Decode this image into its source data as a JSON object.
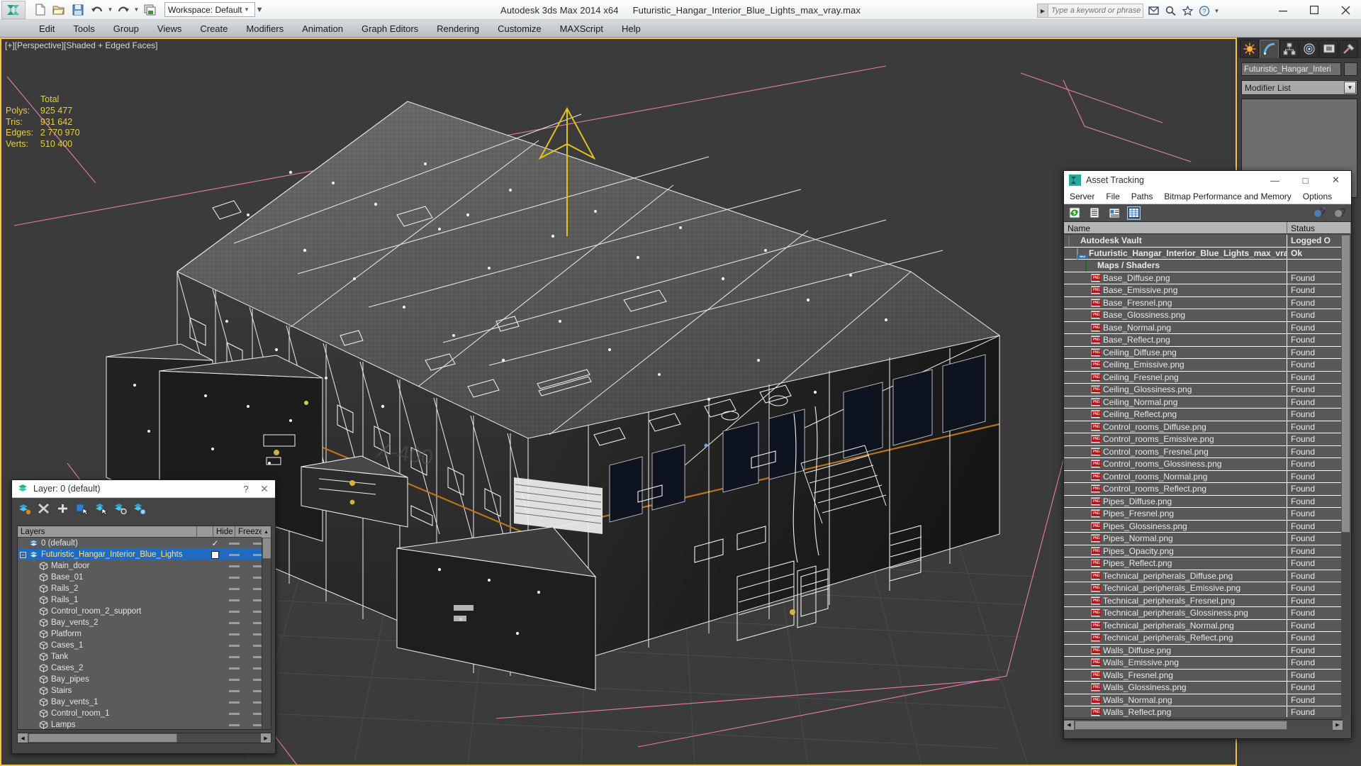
{
  "app": {
    "title_product": "Autodesk 3ds Max  2014 x64",
    "title_file": "Futuristic_Hangar_Interior_Blue_Lights_max_vray.max",
    "workspace_label": "Workspace: Default",
    "search_placeholder": "Type a keyword or phrase",
    "quick_access": [
      "new-file-icon",
      "open-file-icon",
      "save-file-icon",
      "undo-icon",
      "redo-icon",
      "project-folder-icon"
    ],
    "window_buttons": [
      "minimize",
      "maximize",
      "close"
    ]
  },
  "menubar": {
    "items": [
      "Edit",
      "Tools",
      "Group",
      "Views",
      "Create",
      "Modifiers",
      "Animation",
      "Graph Editors",
      "Rendering",
      "Customize",
      "MAXScript",
      "Help"
    ]
  },
  "viewport": {
    "label": "[+][Perspective][Shaded + Edged Faces]",
    "stats_header": "Total",
    "stats": [
      {
        "label": "Polys:",
        "value": "925 477"
      },
      {
        "label": "Tris:",
        "value": "931 642"
      },
      {
        "label": "Edges:",
        "value": "2 770 970"
      },
      {
        "label": "Verts:",
        "value": "510 400"
      }
    ],
    "stats_color": "#e9cf3a",
    "active_border_color": "#f2c744"
  },
  "command_panel": {
    "tabs": [
      "create-tab",
      "modify-tab",
      "hierarchy-tab",
      "motion-tab",
      "display-tab",
      "utilities-tab"
    ],
    "active_tab_index": 1,
    "object_name": "Futuristic_Hangar_Interi",
    "modifier_list_label": "Modifier List"
  },
  "layer_dialog": {
    "title": "Layer: 0 (default)",
    "help_label": "?",
    "close_label": "✕",
    "toolbar": [
      "delete-layer-icon",
      "remove-layer-icon",
      "add-layer-icon",
      "select-objects-icon",
      "select-highlighted-icon",
      "highlight-selected-icon",
      "layer-properties-icon"
    ],
    "columns": [
      "Layers",
      "",
      "Hide",
      "Freeze"
    ],
    "rows": [
      {
        "name": "0 (default)",
        "indent": 1,
        "icon": "layer-icon",
        "check": "✓",
        "selected": false
      },
      {
        "name": "Futuristic_Hangar_Interior_Blue_Lights",
        "indent": 1,
        "icon": "layer-icon",
        "check": "box",
        "selected": true,
        "expander": "−"
      },
      {
        "name": "Main_door",
        "indent": 2,
        "icon": "object-icon",
        "selected": false
      },
      {
        "name": "Base_01",
        "indent": 2,
        "icon": "object-icon",
        "selected": false
      },
      {
        "name": "Rails_2",
        "indent": 2,
        "icon": "object-icon",
        "selected": false
      },
      {
        "name": "Rails_1",
        "indent": 2,
        "icon": "object-icon",
        "selected": false
      },
      {
        "name": "Control_room_2_support",
        "indent": 2,
        "icon": "object-icon",
        "selected": false
      },
      {
        "name": "Bay_vents_2",
        "indent": 2,
        "icon": "object-icon",
        "selected": false
      },
      {
        "name": "Platform",
        "indent": 2,
        "icon": "object-icon",
        "selected": false
      },
      {
        "name": "Cases_1",
        "indent": 2,
        "icon": "object-icon",
        "selected": false
      },
      {
        "name": "Tank",
        "indent": 2,
        "icon": "object-icon",
        "selected": false
      },
      {
        "name": "Cases_2",
        "indent": 2,
        "icon": "object-icon",
        "selected": false
      },
      {
        "name": "Bay_pipes",
        "indent": 2,
        "icon": "object-icon",
        "selected": false
      },
      {
        "name": "Stairs",
        "indent": 2,
        "icon": "object-icon",
        "selected": false
      },
      {
        "name": "Bay_vents_1",
        "indent": 2,
        "icon": "object-icon",
        "selected": false
      },
      {
        "name": "Control_room_1",
        "indent": 2,
        "icon": "object-icon",
        "selected": false
      },
      {
        "name": "Lamps",
        "indent": 2,
        "icon": "object-icon",
        "selected": false
      }
    ]
  },
  "asset_tracking": {
    "title": "Asset Tracking",
    "window_buttons": [
      "—",
      "□",
      "✕"
    ],
    "menu": [
      "Server",
      "File",
      "Paths",
      "Bitmap Performance and Memory",
      "Options"
    ],
    "toolbar": [
      "refresh-icon",
      "list-view-icon",
      "detail-view-icon",
      "grid-view-icon"
    ],
    "toolbar_active_index": 3,
    "toolbar_right": [
      "check-in-icon",
      "check-out-icon"
    ],
    "columns": [
      "Name",
      "Status"
    ],
    "rows": [
      {
        "name": "Autodesk Vault",
        "status": "Logged O",
        "level": 0,
        "icon": "vault-icon"
      },
      {
        "name": "Futuristic_Hangar_Interior_Blue_Lights_max_vray.max",
        "status": "Ok",
        "level": 1,
        "icon": "max-icon"
      },
      {
        "name": "Maps / Shaders",
        "status": "",
        "level": 2,
        "icon": "shader-icon"
      },
      {
        "name": "Base_Diffuse.png",
        "status": "Found",
        "level": 3,
        "icon": "png-icon"
      },
      {
        "name": "Base_Emissive.png",
        "status": "Found",
        "level": 3,
        "icon": "png-icon"
      },
      {
        "name": "Base_Fresnel.png",
        "status": "Found",
        "level": 3,
        "icon": "png-icon"
      },
      {
        "name": "Base_Glossiness.png",
        "status": "Found",
        "level": 3,
        "icon": "png-icon"
      },
      {
        "name": "Base_Normal.png",
        "status": "Found",
        "level": 3,
        "icon": "png-icon"
      },
      {
        "name": "Base_Reflect.png",
        "status": "Found",
        "level": 3,
        "icon": "png-icon"
      },
      {
        "name": "Ceiling_Diffuse.png",
        "status": "Found",
        "level": 3,
        "icon": "png-icon"
      },
      {
        "name": "Ceiling_Emissive.png",
        "status": "Found",
        "level": 3,
        "icon": "png-icon"
      },
      {
        "name": "Ceiling_Fresnel.png",
        "status": "Found",
        "level": 3,
        "icon": "png-icon"
      },
      {
        "name": "Ceiling_Glossiness.png",
        "status": "Found",
        "level": 3,
        "icon": "png-icon"
      },
      {
        "name": "Ceiling_Normal.png",
        "status": "Found",
        "level": 3,
        "icon": "png-icon"
      },
      {
        "name": "Ceiling_Reflect.png",
        "status": "Found",
        "level": 3,
        "icon": "png-icon"
      },
      {
        "name": "Control_rooms_Diffuse.png",
        "status": "Found",
        "level": 3,
        "icon": "png-icon"
      },
      {
        "name": "Control_rooms_Emissive.png",
        "status": "Found",
        "level": 3,
        "icon": "png-icon"
      },
      {
        "name": "Control_rooms_Fresnel.png",
        "status": "Found",
        "level": 3,
        "icon": "png-icon"
      },
      {
        "name": "Control_rooms_Glossiness.png",
        "status": "Found",
        "level": 3,
        "icon": "png-icon"
      },
      {
        "name": "Control_rooms_Normal.png",
        "status": "Found",
        "level": 3,
        "icon": "png-icon"
      },
      {
        "name": "Control_rooms_Reflect.png",
        "status": "Found",
        "level": 3,
        "icon": "png-icon"
      },
      {
        "name": "Pipes_Diffuse.png",
        "status": "Found",
        "level": 3,
        "icon": "png-icon"
      },
      {
        "name": "Pipes_Fresnel.png",
        "status": "Found",
        "level": 3,
        "icon": "png-icon"
      },
      {
        "name": "Pipes_Glossiness.png",
        "status": "Found",
        "level": 3,
        "icon": "png-icon"
      },
      {
        "name": "Pipes_Normal.png",
        "status": "Found",
        "level": 3,
        "icon": "png-icon"
      },
      {
        "name": "Pipes_Opacity.png",
        "status": "Found",
        "level": 3,
        "icon": "png-icon"
      },
      {
        "name": "Pipes_Reflect.png",
        "status": "Found",
        "level": 3,
        "icon": "png-icon"
      },
      {
        "name": "Technical_peripherals_Diffuse.png",
        "status": "Found",
        "level": 3,
        "icon": "png-icon"
      },
      {
        "name": "Technical_peripherals_Emissive.png",
        "status": "Found",
        "level": 3,
        "icon": "png-icon"
      },
      {
        "name": "Technical_peripherals_Fresnel.png",
        "status": "Found",
        "level": 3,
        "icon": "png-icon"
      },
      {
        "name": "Technical_peripherals_Glossiness.png",
        "status": "Found",
        "level": 3,
        "icon": "png-icon"
      },
      {
        "name": "Technical_peripherals_Normal.png",
        "status": "Found",
        "level": 3,
        "icon": "png-icon"
      },
      {
        "name": "Technical_peripherals_Reflect.png",
        "status": "Found",
        "level": 3,
        "icon": "png-icon"
      },
      {
        "name": "Walls_Diffuse.png",
        "status": "Found",
        "level": 3,
        "icon": "png-icon"
      },
      {
        "name": "Walls_Emissive.png",
        "status": "Found",
        "level": 3,
        "icon": "png-icon"
      },
      {
        "name": "Walls_Fresnel.png",
        "status": "Found",
        "level": 3,
        "icon": "png-icon"
      },
      {
        "name": "Walls_Glossiness.png",
        "status": "Found",
        "level": 3,
        "icon": "png-icon"
      },
      {
        "name": "Walls_Normal.png",
        "status": "Found",
        "level": 3,
        "icon": "png-icon"
      },
      {
        "name": "Walls_Reflect.png",
        "status": "Found",
        "level": 3,
        "icon": "png-icon"
      }
    ]
  }
}
